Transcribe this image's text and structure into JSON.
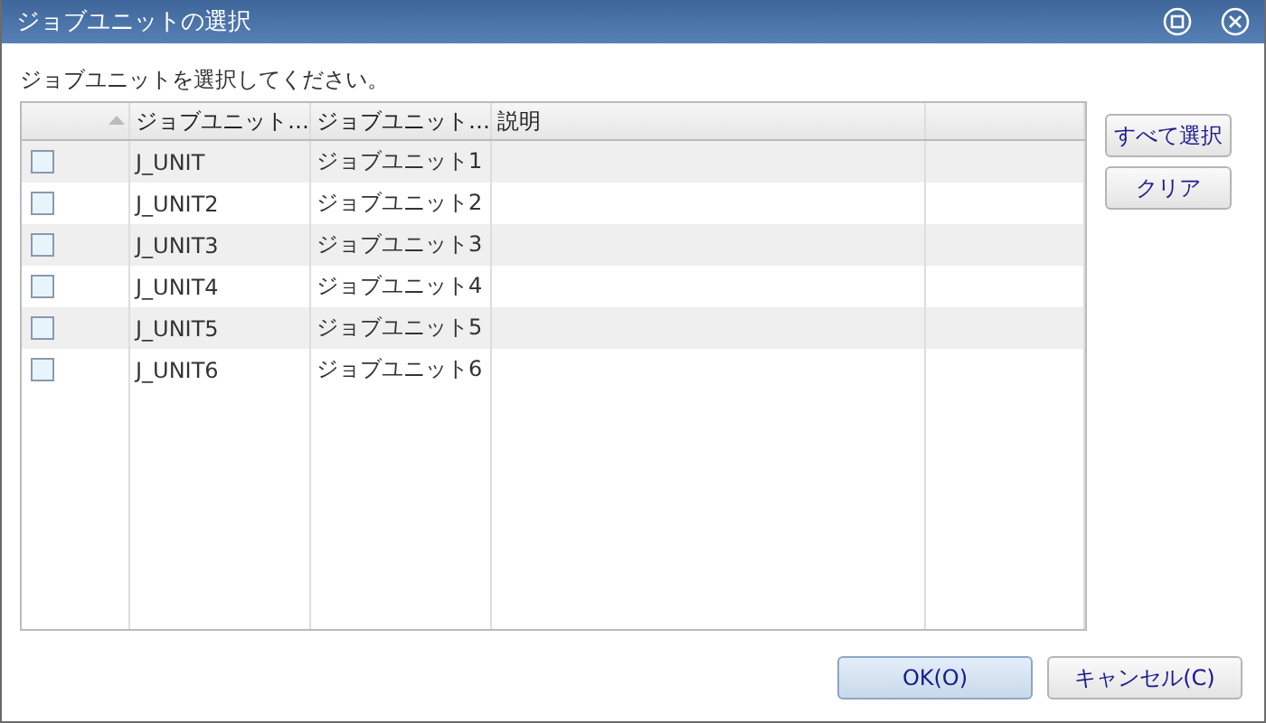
{
  "window": {
    "title": "ジョブユニットの選択"
  },
  "instruction": "ジョブユニットを選択してください。",
  "table": {
    "columns": [
      "ジョブユニット…",
      "ジョブユニット…",
      "説明"
    ],
    "rows": [
      {
        "checked": false,
        "cells": [
          "J_UNIT",
          "ジョブユニット1",
          ""
        ]
      },
      {
        "checked": false,
        "cells": [
          "J_UNIT2",
          "ジョブユニット2",
          ""
        ]
      },
      {
        "checked": false,
        "cells": [
          "J_UNIT3",
          "ジョブユニット3",
          ""
        ]
      },
      {
        "checked": false,
        "cells": [
          "J_UNIT4",
          "ジョブユニット4",
          ""
        ]
      },
      {
        "checked": false,
        "cells": [
          "J_UNIT5",
          "ジョブユニット5",
          ""
        ]
      },
      {
        "checked": false,
        "cells": [
          "J_UNIT6",
          "ジョブユニット6",
          ""
        ]
      }
    ]
  },
  "side_buttons": [
    "すべて選択",
    "クリア"
  ],
  "buttons": [
    {
      "label": "OK(O)",
      "kind": "default"
    },
    {
      "label": "キャンセル(C)",
      "kind": "normal"
    }
  ]
}
